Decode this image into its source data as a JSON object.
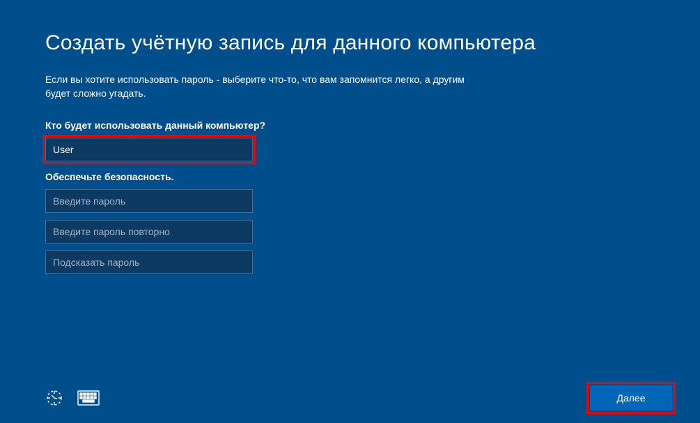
{
  "page": {
    "title": "Создать учётную запись для данного компьютера",
    "subtitle": "Если вы хотите использовать пароль - выберите что-то, что вам запомнится легко, а другим будет сложно угадать."
  },
  "section_user": {
    "label": "Кто будет использовать данный компьютер?",
    "username_value": "User"
  },
  "section_security": {
    "label": "Обеспечьте безопасность.",
    "password_placeholder": "Введите пароль",
    "password_confirm_placeholder": "Введите пароль повторно",
    "password_hint_placeholder": "Подсказать пароль"
  },
  "buttons": {
    "next_label": "Далее"
  },
  "icons": {
    "accessibility": "accessibility-icon",
    "keyboard": "keyboard-icon"
  }
}
